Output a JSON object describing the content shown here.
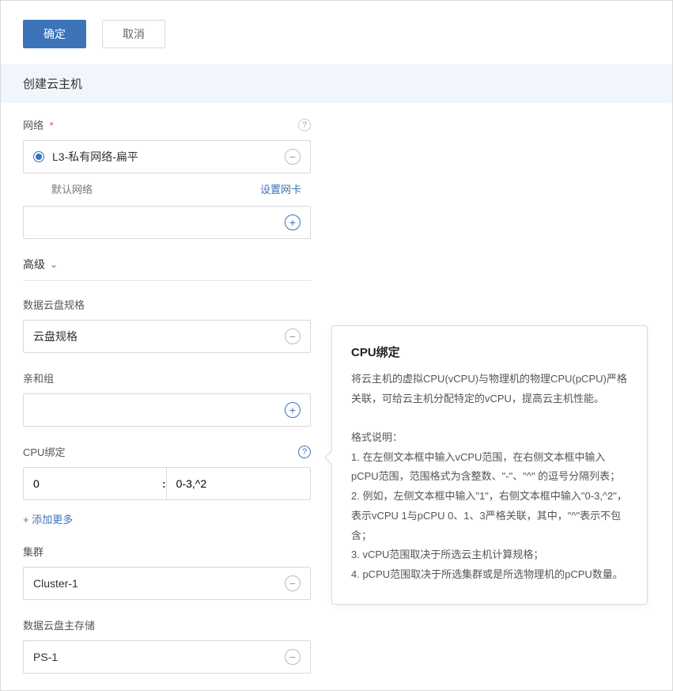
{
  "buttons": {
    "confirm": "确定",
    "cancel": "取消"
  },
  "page_title": "创建云主机",
  "network": {
    "label": "网络",
    "required_mark": "*",
    "selected": "L3-私有网络-扁平",
    "default_label": "默认网络",
    "set_nic": "设置网卡"
  },
  "advanced_label": "高级",
  "disk_spec": {
    "label": "数据云盘规格",
    "value": "云盘规格"
  },
  "affinity": {
    "label": "亲和组"
  },
  "cpu_binding": {
    "label": "CPU绑定",
    "vcpu": "0",
    "separator": ":",
    "pcpu": "0-3,^2"
  },
  "add_more": "+ 添加更多",
  "cluster": {
    "label": "集群",
    "value": "Cluster-1"
  },
  "primary_storage": {
    "label": "数据云盘主存储",
    "value": "PS-1"
  },
  "tooltip": {
    "title": "CPU绑定",
    "intro": "将云主机的虚拟CPU(vCPU)与物理机的物理CPU(pCPU)严格关联，可给云主机分配特定的vCPU，提高云主机性能。",
    "format_label": "格式说明：",
    "line1": "1. 在左侧文本框中输入vCPU范围，在右侧文本框中输入pCPU范围，范围格式为含整数、\"-\"、\"^\" 的逗号分隔列表；",
    "line2": "2. 例如，左侧文本框中输入\"1\"，右侧文本框中输入\"0-3,^2\"，表示vCPU 1与pCPU 0、1、3严格关联，其中，\"^\"表示不包含；",
    "line3": "3. vCPU范围取决于所选云主机计算规格；",
    "line4": "4. pCPU范围取决于所选集群或是所选物理机的pCPU数量。"
  }
}
